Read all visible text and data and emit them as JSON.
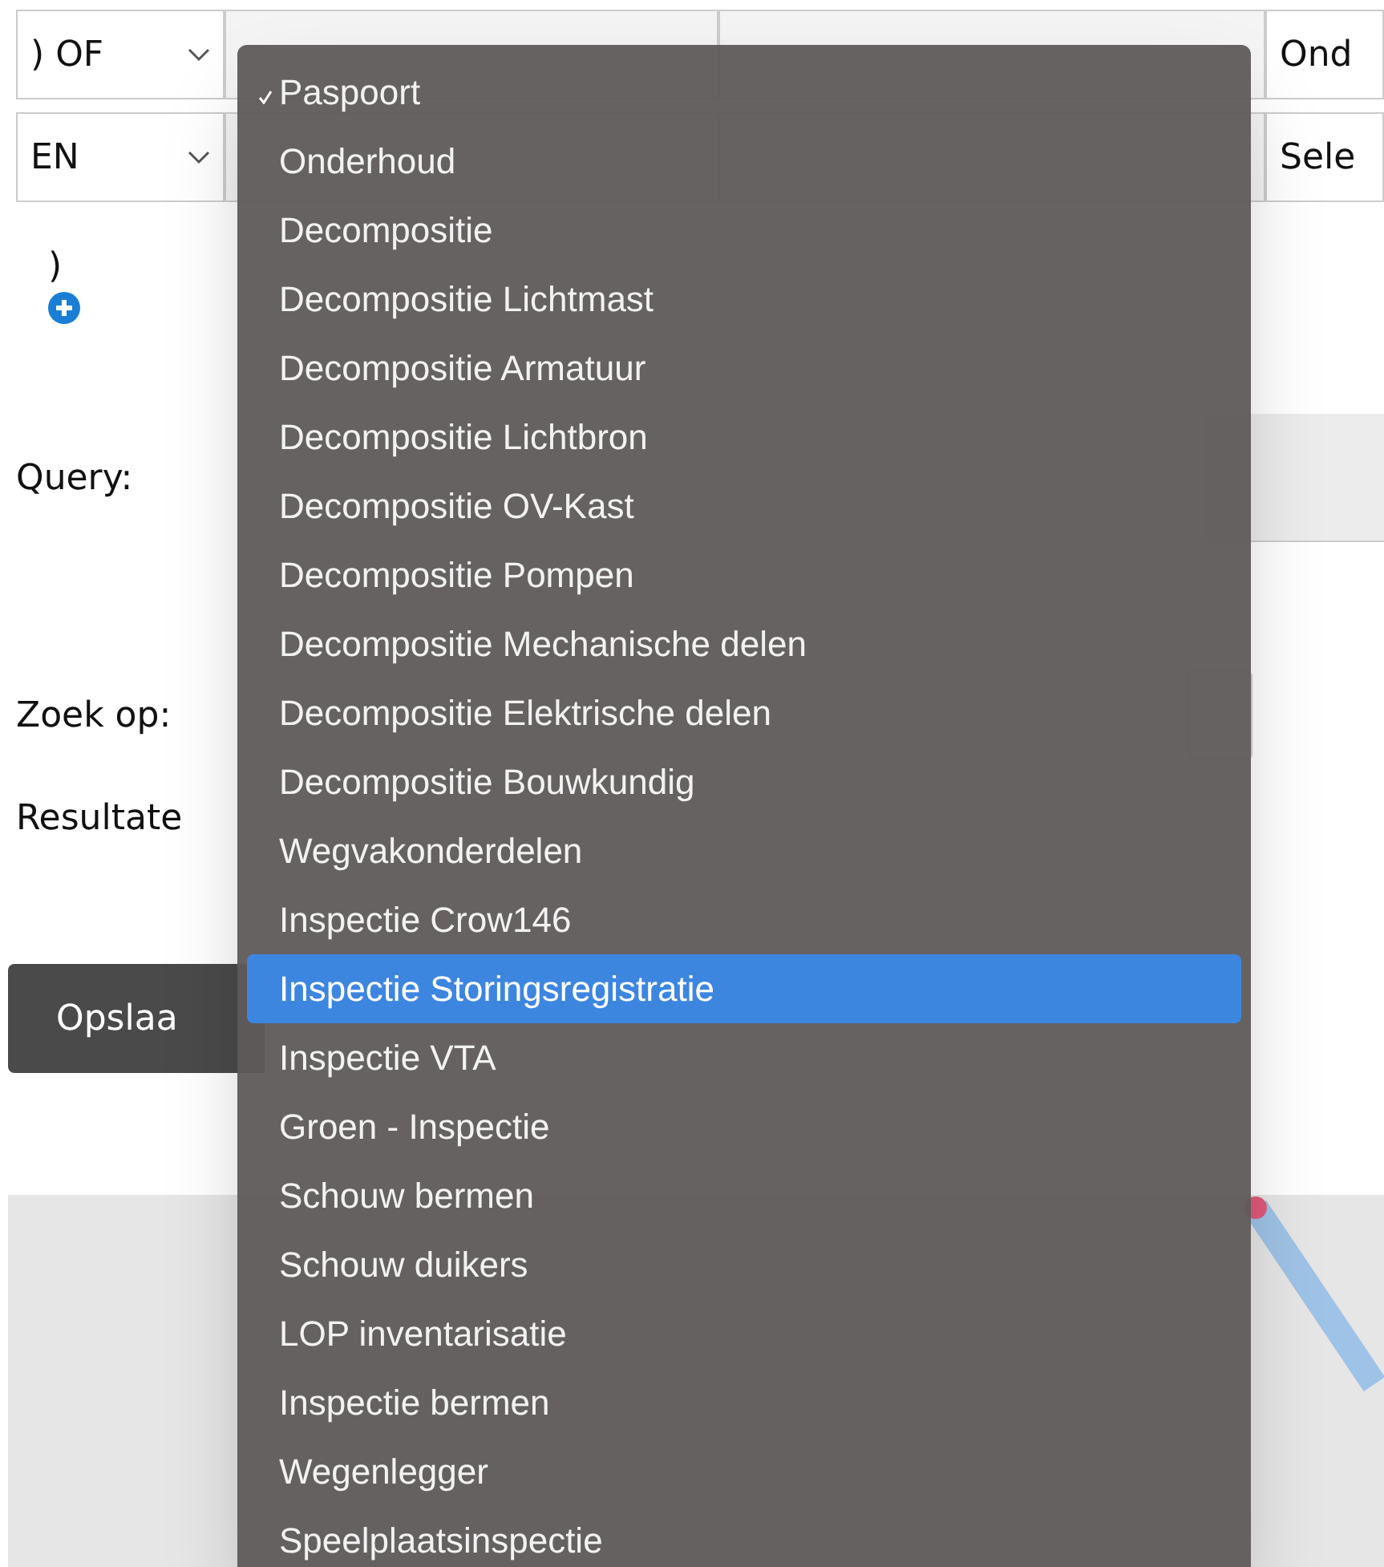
{
  "filter_rows": [
    {
      "operator": ") OF",
      "column_4": "Ond"
    },
    {
      "operator": "EN",
      "column_4": "Sele"
    }
  ],
  "closing_paren": ")",
  "query_label": "Query:",
  "search_label": "Zoek op:",
  "results_label": "Resultate",
  "save_button": "Opslaa",
  "dropdown_menu": {
    "items": [
      {
        "label": "Paspoort",
        "checked": true,
        "selected": false
      },
      {
        "label": "Onderhoud",
        "checked": false,
        "selected": false
      },
      {
        "label": "Decompositie",
        "checked": false,
        "selected": false
      },
      {
        "label": "Decompositie Lichtmast",
        "checked": false,
        "selected": false
      },
      {
        "label": "Decompositie Armatuur",
        "checked": false,
        "selected": false
      },
      {
        "label": "Decompositie Lichtbron",
        "checked": false,
        "selected": false
      },
      {
        "label": "Decompositie OV-Kast",
        "checked": false,
        "selected": false
      },
      {
        "label": "Decompositie Pompen",
        "checked": false,
        "selected": false
      },
      {
        "label": "Decompositie Mechanische delen",
        "checked": false,
        "selected": false
      },
      {
        "label": "Decompositie Elektrische delen",
        "checked": false,
        "selected": false
      },
      {
        "label": "Decompositie Bouwkundig",
        "checked": false,
        "selected": false
      },
      {
        "label": "Wegvakonderdelen",
        "checked": false,
        "selected": false
      },
      {
        "label": "Inspectie Crow146",
        "checked": false,
        "selected": false
      },
      {
        "label": "Inspectie Storingsregistratie",
        "checked": false,
        "selected": true
      },
      {
        "label": "Inspectie VTA",
        "checked": false,
        "selected": false
      },
      {
        "label": "Groen - Inspectie",
        "checked": false,
        "selected": false
      },
      {
        "label": "Schouw bermen",
        "checked": false,
        "selected": false
      },
      {
        "label": "Schouw duikers",
        "checked": false,
        "selected": false
      },
      {
        "label": "LOP inventarisatie",
        "checked": false,
        "selected": false
      },
      {
        "label": "Inspectie bermen",
        "checked": false,
        "selected": false
      },
      {
        "label": "Wegenlegger",
        "checked": false,
        "selected": false
      },
      {
        "label": "Speelplaatsinspectie",
        "checked": false,
        "selected": false
      }
    ]
  }
}
